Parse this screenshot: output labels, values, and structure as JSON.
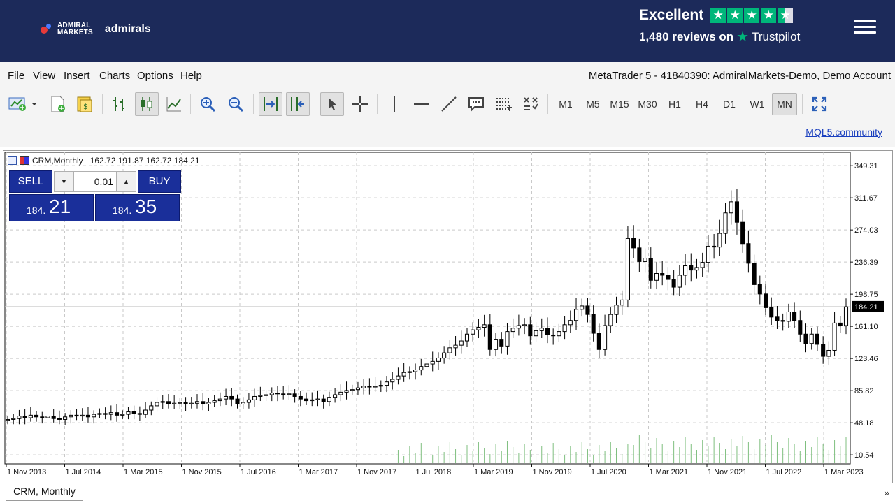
{
  "header": {
    "logo_line1": "ADMIRAL",
    "logo_line2": "MARKETS",
    "logo_name": "admirals",
    "trustpilot_rating_text": "Excellent",
    "trustpilot_stars": 4.5,
    "reviews_count_text": "1,480 reviews on",
    "trustpilot_brand": "Trustpilot",
    "background_color": "#1c2a5a"
  },
  "menu": {
    "items": [
      "File",
      "View",
      "Insert",
      "Charts",
      "Options",
      "Help"
    ],
    "account_title": "MetaTrader 5 - 41840390: AdmiralMarkets-Demo, Demo Account"
  },
  "toolbar": {
    "icons": [
      "new-chart-icon",
      "new-order-icon",
      "market-watch-icon",
      "bar-chart-icon",
      "candlestick-chart-icon",
      "line-chart-icon",
      "zoom-in-icon",
      "zoom-out-icon",
      "autoscroll-icon",
      "chart-shift-icon",
      "cursor-icon",
      "crosshair-icon",
      "vertical-line-icon",
      "horizontal-line-icon",
      "trendline-icon",
      "text-label-icon",
      "fibonacci-icon",
      "objects-list-icon",
      "fullscreen-icon"
    ],
    "timeframes": [
      "M1",
      "M5",
      "M15",
      "M30",
      "H1",
      "H4",
      "D1",
      "W1",
      "MN"
    ],
    "active_timeframe": "MN",
    "mql_link": "MQL5.community"
  },
  "chart": {
    "info": {
      "symbol_period": "CRM,Monthly",
      "ohlc": "162.72 191.87 162.72 184.21"
    },
    "trade_panel": {
      "sell_label": "SELL",
      "buy_label": "BUY",
      "lot": "0.01",
      "sell_price_small": "184.",
      "sell_price_big": "21",
      "buy_price_small": "184.",
      "buy_price_big": "35"
    },
    "tab_label": "CRM, Monthly",
    "scroll_arrows": "»"
  },
  "chart_data": {
    "type": "candlestick",
    "symbol": "CRM",
    "period": "Monthly",
    "current_price": 184.21,
    "current_price_label": "184.21",
    "y_ticks": [
      "349.31",
      "311.67",
      "274.03",
      "236.39",
      "198.75",
      "161.10",
      "123.46",
      "85.82",
      "48.18",
      "10.54"
    ],
    "y_tick_values": [
      349.31,
      311.67,
      274.03,
      236.39,
      198.75,
      161.1,
      123.46,
      85.82,
      48.18,
      10.54
    ],
    "x_ticks": [
      "1 Nov 2013",
      "1 Jul 2014",
      "1 Mar 2015",
      "1 Nov 2015",
      "1 Jul 2016",
      "1 Mar 2017",
      "1 Nov 2017",
      "1 Jul 2018",
      "1 Mar 2019",
      "1 Nov 2019",
      "1 Jul 2020",
      "1 Mar 2021",
      "1 Nov 2021",
      "1 Jul 2022",
      "1 Mar 2023"
    ],
    "ylim": [
      0,
      365
    ],
    "grid": true,
    "closes": [
      52,
      53,
      56,
      54,
      57,
      55,
      54,
      56,
      53,
      52,
      55,
      57,
      56,
      57,
      55,
      58,
      59,
      58,
      60,
      57,
      58,
      61,
      59,
      58,
      63,
      68,
      72,
      73,
      70,
      71,
      72,
      70,
      71,
      73,
      70,
      72,
      74,
      76,
      79,
      76,
      70,
      72,
      75,
      79,
      80,
      81,
      83,
      82,
      81,
      82,
      79,
      76,
      74,
      75,
      76,
      73,
      78,
      81,
      84,
      86,
      87,
      89,
      91,
      90,
      91,
      92,
      96,
      99,
      103,
      107,
      108,
      110,
      114,
      117,
      120,
      124,
      130,
      136,
      139,
      144,
      152,
      157,
      160,
      163,
      134,
      146,
      138,
      155,
      159,
      162,
      163,
      150,
      156,
      159,
      151,
      150,
      155,
      163,
      168,
      181,
      185,
      175,
      153,
      134,
      162,
      175,
      186,
      192,
      264,
      253,
      237,
      241,
      215,
      223,
      221,
      216,
      207,
      221,
      232,
      227,
      230,
      236,
      255,
      254,
      270,
      294,
      307,
      283,
      258,
      235,
      210,
      199,
      183,
      172,
      168,
      167,
      178,
      168,
      152,
      141,
      152,
      140,
      126,
      133,
      165,
      162,
      184
    ]
  }
}
